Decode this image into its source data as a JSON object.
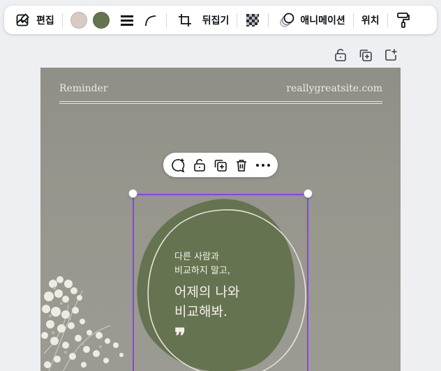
{
  "toolbar": {
    "edit_label": "편집",
    "flip_label": "뒤집기",
    "animate_label": "애니메이션",
    "position_label": "위치",
    "swatch_colors": [
      "#d7cbc3",
      "#657350"
    ],
    "icons": [
      "image-edit-icon",
      "line-weight-icon",
      "corner-rounding-icon",
      "crop-icon",
      "transparency-icon",
      "animate-icon",
      "paint-roller-icon"
    ]
  },
  "page_actions": {
    "icons": [
      "lock-icon",
      "duplicate-page-icon",
      "add-page-icon"
    ]
  },
  "canvas": {
    "header_left": "Reminder",
    "header_right": "reallygreatsite.com",
    "body_small_line1": "다른 사람과",
    "body_small_line2": "비교하지 말고,",
    "body_big_line1": "어제의 나와",
    "body_big_line2": "비교해봐.",
    "quote_mark": "❞",
    "colors": {
      "background": "#94948b",
      "blob": "#657350",
      "text": "#f4f1ea"
    }
  },
  "element_toolbar": {
    "icons": [
      "comment-add-icon",
      "lock-icon",
      "duplicate-icon",
      "trash-icon",
      "more-icon"
    ]
  },
  "selection_color": "#8b3dff"
}
